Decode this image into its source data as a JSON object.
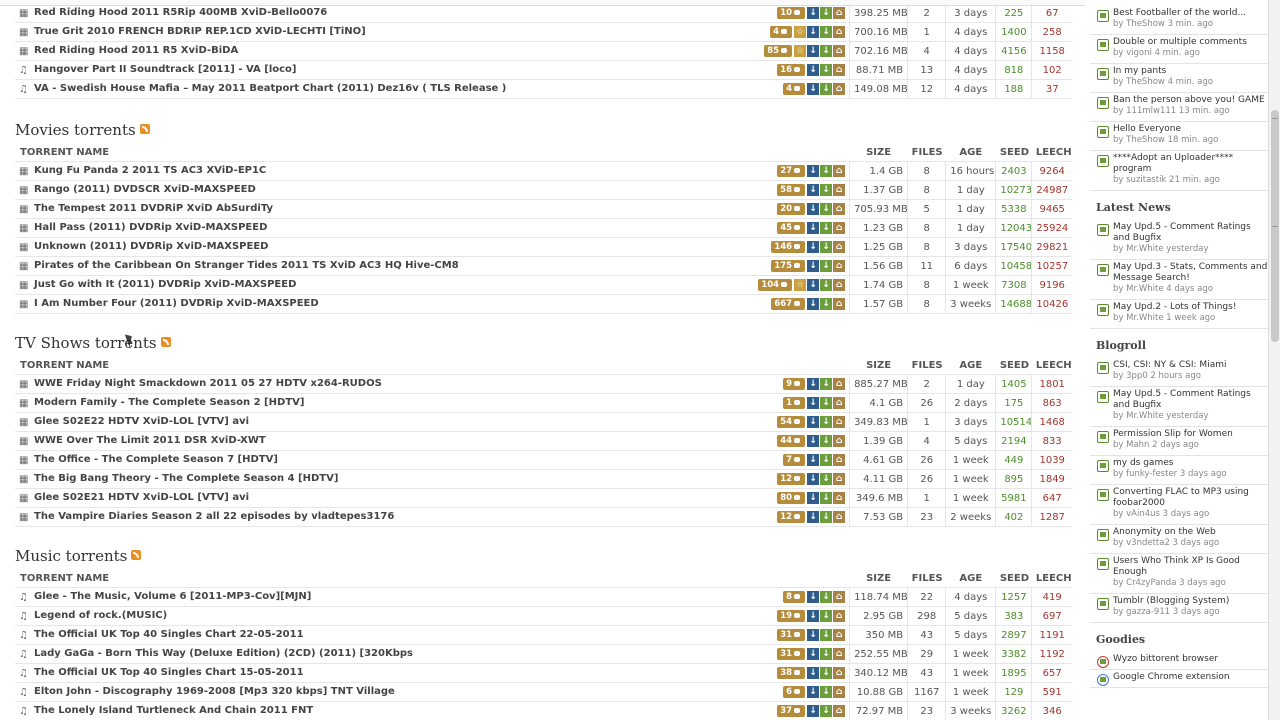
{
  "top_rows": [
    {
      "name": "Red Riding Hood 2011 R5Rip 400MB XviD-Bello0076",
      "type": "film",
      "comments": "10",
      "verified": false,
      "size": "398.25 MB",
      "files": "2",
      "age": "3 days",
      "seed": "225",
      "leech": "67"
    },
    {
      "name": "True Grit 2010 FRENCH BDRIP REP.1CD XViD-LECHTI [TiNO]",
      "type": "film",
      "comments": "4",
      "verified": true,
      "size": "700.16 MB",
      "files": "1",
      "age": "4 days",
      "seed": "1400",
      "leech": "258"
    },
    {
      "name": "Red Riding Hood 2011 R5 XviD-BiDA",
      "type": "film",
      "comments": "85",
      "verified": true,
      "size": "702.16 MB",
      "files": "4",
      "age": "4 days",
      "seed": "4156",
      "leech": "1158"
    },
    {
      "name": "Hangover Part II Soundtrack [2011] - VA [loco]",
      "type": "music",
      "comments": "16",
      "verified": false,
      "size": "88.71 MB",
      "files": "13",
      "age": "4 days",
      "seed": "818",
      "leech": "102"
    },
    {
      "name": "VA - Swedish House Mafia – May 2011 Beatport Chart (2011) Dez16v ( TLS Release )",
      "type": "music",
      "comments": "4",
      "verified": false,
      "size": "149.08 MB",
      "files": "12",
      "age": "4 days",
      "seed": "188",
      "leech": "37"
    }
  ],
  "columns": {
    "name": "TORRENT NAME",
    "size": "SIZE",
    "files": "FILES",
    "age": "AGE",
    "seed": "SEED",
    "leech": "LEECH"
  },
  "sections": [
    {
      "title": "Movies torrents",
      "rows": [
        {
          "name": "Kung Fu Panda 2 2011 TS AC3 XViD-EP1C",
          "type": "film",
          "comments": "27",
          "verified": false,
          "size": "1.4 GB",
          "files": "8",
          "age": "16 hours",
          "seed": "2403",
          "leech": "9264"
        },
        {
          "name": "Rango (2011) DVDSCR XviD-MAXSPEED",
          "type": "film",
          "comments": "58",
          "verified": false,
          "size": "1.37 GB",
          "files": "8",
          "age": "1 day",
          "seed": "10273",
          "leech": "24987"
        },
        {
          "name": "The Tempest 2011 DVDRiP XviD AbSurdiTy",
          "type": "film",
          "comments": "20",
          "verified": false,
          "size": "705.93 MB",
          "files": "5",
          "age": "1 day",
          "seed": "5338",
          "leech": "9465"
        },
        {
          "name": "Hall Pass (2011) DVDRip XviD-MAXSPEED",
          "type": "film",
          "comments": "45",
          "verified": false,
          "size": "1.23 GB",
          "files": "8",
          "age": "1 day",
          "seed": "12043",
          "leech": "25924"
        },
        {
          "name": "Unknown (2011) DVDRip XviD-MAXSPEED",
          "type": "film",
          "comments": "146",
          "verified": false,
          "size": "1.25 GB",
          "files": "8",
          "age": "3 days",
          "seed": "17540",
          "leech": "29821"
        },
        {
          "name": "Pirates of the Caribbean On Stranger Tides 2011 TS XviD AC3 HQ Hive-CM8",
          "type": "film",
          "comments": "175",
          "verified": false,
          "size": "1.56 GB",
          "files": "11",
          "age": "6 days",
          "seed": "10458",
          "leech": "10257"
        },
        {
          "name": "Just Go with It (2011) DVDRip XviD-MAXSPEED",
          "type": "film",
          "comments": "104",
          "verified": true,
          "size": "1.74 GB",
          "files": "8",
          "age": "1 week",
          "seed": "7308",
          "leech": "9196"
        },
        {
          "name": "I Am Number Four (2011) DVDRip XviD-MAXSPEED",
          "type": "film",
          "comments": "667",
          "verified": false,
          "size": "1.57 GB",
          "files": "8",
          "age": "3 weeks",
          "seed": "14688",
          "leech": "10426"
        }
      ]
    },
    {
      "title": "TV Shows torrents",
      "rows": [
        {
          "name": "WWE Friday Night Smackdown 2011 05 27 HDTV x264-RUDOS",
          "type": "film",
          "comments": "9",
          "verified": false,
          "size": "885.27 MB",
          "files": "2",
          "age": "1 day",
          "seed": "1405",
          "leech": "1801"
        },
        {
          "name": "Modern Family - The Complete Season 2 [HDTV]",
          "type": "film",
          "comments": "1",
          "verified": false,
          "size": "4.1 GB",
          "files": "26",
          "age": "2 days",
          "seed": "175",
          "leech": "863"
        },
        {
          "name": "Glee S02E22 HDTV XviD-LOL [VTV] avi",
          "type": "film",
          "comments": "54",
          "verified": false,
          "size": "349.83 MB",
          "files": "1",
          "age": "3 days",
          "seed": "10514",
          "leech": "1468"
        },
        {
          "name": "WWE Over The Limit 2011 DSR XviD-XWT",
          "type": "film",
          "comments": "44",
          "verified": false,
          "size": "1.39 GB",
          "files": "4",
          "age": "5 days",
          "seed": "2194",
          "leech": "833"
        },
        {
          "name": "The Office - The Complete Season 7 [HDTV]",
          "type": "film",
          "comments": "7",
          "verified": false,
          "size": "4.61 GB",
          "files": "26",
          "age": "1 week",
          "seed": "449",
          "leech": "1039"
        },
        {
          "name": "The Big Bang Theory - The Complete Season 4 [HDTV]",
          "type": "film",
          "comments": "12",
          "verified": false,
          "size": "4.11 GB",
          "files": "26",
          "age": "1 week",
          "seed": "895",
          "leech": "1849"
        },
        {
          "name": "Glee S02E21 HDTV XviD-LOL [VTV] avi",
          "type": "film",
          "comments": "80",
          "verified": false,
          "size": "349.6 MB",
          "files": "1",
          "age": "1 week",
          "seed": "5981",
          "leech": "647"
        },
        {
          "name": "The Vampire Diaries Season 2 all 22 episodes by vladtepes3176",
          "type": "film",
          "comments": "12",
          "verified": false,
          "size": "7.53 GB",
          "files": "23",
          "age": "2 weeks",
          "seed": "402",
          "leech": "1287"
        }
      ]
    },
    {
      "title": "Music torrents",
      "rows": [
        {
          "name": "Glee - The Music, Volume 6 [2011-MP3-Cov][MJN]",
          "type": "music",
          "comments": "8",
          "verified": false,
          "size": "118.74 MB",
          "files": "22",
          "age": "4 days",
          "seed": "1257",
          "leech": "419"
        },
        {
          "name": "Legend of rock.(MUSIC)",
          "type": "music",
          "comments": "19",
          "verified": false,
          "size": "2.95 GB",
          "files": "298",
          "age": "5 days",
          "seed": "383",
          "leech": "697"
        },
        {
          "name": "The Official UK Top 40 Singles Chart 22-05-2011",
          "type": "music",
          "comments": "31",
          "verified": false,
          "size": "350 MB",
          "files": "43",
          "age": "5 days",
          "seed": "2897",
          "leech": "1191"
        },
        {
          "name": "Lady GaGa - Born This Way (Deluxe Edition) (2CD) (2011) [320Kbps",
          "type": "music",
          "comments": "31",
          "verified": false,
          "size": "252.55 MB",
          "files": "29",
          "age": "1 week",
          "seed": "3382",
          "leech": "1192"
        },
        {
          "name": "The Official UK Top 40 Singles Chart 15-05-2011",
          "type": "music",
          "comments": "38",
          "verified": false,
          "size": "340.12 MB",
          "files": "43",
          "age": "1 week",
          "seed": "1895",
          "leech": "657"
        },
        {
          "name": "Elton John - Discography 1969-2008 [Mp3 320 kbps] TNT Village",
          "type": "music",
          "comments": "6",
          "verified": false,
          "size": "10.88 GB",
          "files": "1167",
          "age": "1 week",
          "seed": "129",
          "leech": "591"
        },
        {
          "name": "The Lonely Island Turtleneck And Chain 2011 FNT",
          "type": "music",
          "comments": "37",
          "verified": false,
          "size": "72.97 MB",
          "files": "23",
          "age": "3 weeks",
          "seed": "3262",
          "leech": "346"
        }
      ]
    }
  ],
  "sidebar": {
    "recent": [
      {
        "title": "Best Footballer of the world...",
        "meta": "by TheShow 3 min. ago"
      },
      {
        "title": "Double or multiple comments",
        "meta": "by vigoni 4 min. ago"
      },
      {
        "title": "In my pants",
        "meta": "by TheShow 4 min. ago"
      },
      {
        "title": "Ban the person above you! GAME",
        "meta": "by 111mlw111 13 min. ago"
      },
      {
        "title": "Hello Everyone",
        "meta": "by TheShow 18 min. ago"
      },
      {
        "title": "****Adopt an Uploader**** program",
        "meta": "by suzitastik 21 min. ago"
      }
    ],
    "news_title": "Latest News",
    "news": [
      {
        "title": "May Upd.5 - Comment Ratings and Bugfix",
        "meta": "by Mr.White yesterday"
      },
      {
        "title": "May Upd.3 - Stats, Comments and Message Search!",
        "meta": "by Mr.White 4 days ago"
      },
      {
        "title": "May Upd.2 - Lots of Things!",
        "meta": "by Mr.White 1 week ago"
      }
    ],
    "blog_title": "Blogroll",
    "blog": [
      {
        "title": "CSI, CSI: NY & CSI: Miami",
        "meta": "by 3pp0 2 hours ago"
      },
      {
        "title": "May Upd.5 - Comment Ratings and Bugfix",
        "meta": "by Mr.White yesterday"
      },
      {
        "title": "Permission Slip for Women",
        "meta": "by Mahn 2 days ago"
      },
      {
        "title": "my ds games",
        "meta": "by funky-fester 3 days ago"
      },
      {
        "title": "Converting FLAC to MP3 using foobar2000",
        "meta": "by vAin4us 3 days ago"
      },
      {
        "title": "Anonymity on the Web",
        "meta": "by v3ndetta2 3 days ago"
      },
      {
        "title": "Users Who Think XP Is Good Enough",
        "meta": "by Cr4zyPanda 3 days ago"
      },
      {
        "title": "Tumblr (Blogging System)",
        "meta": "by gazza-911 3 days ago"
      }
    ],
    "goodies_title": "Goodies",
    "goodies": [
      {
        "title": "Wyzo bittorent browser"
      },
      {
        "title": "Google Chrome extension"
      }
    ]
  },
  "colors": {
    "accent": "#b58b3c",
    "seed": "#4c8d2a",
    "leech": "#a3352d",
    "rss": "#e98f24"
  }
}
